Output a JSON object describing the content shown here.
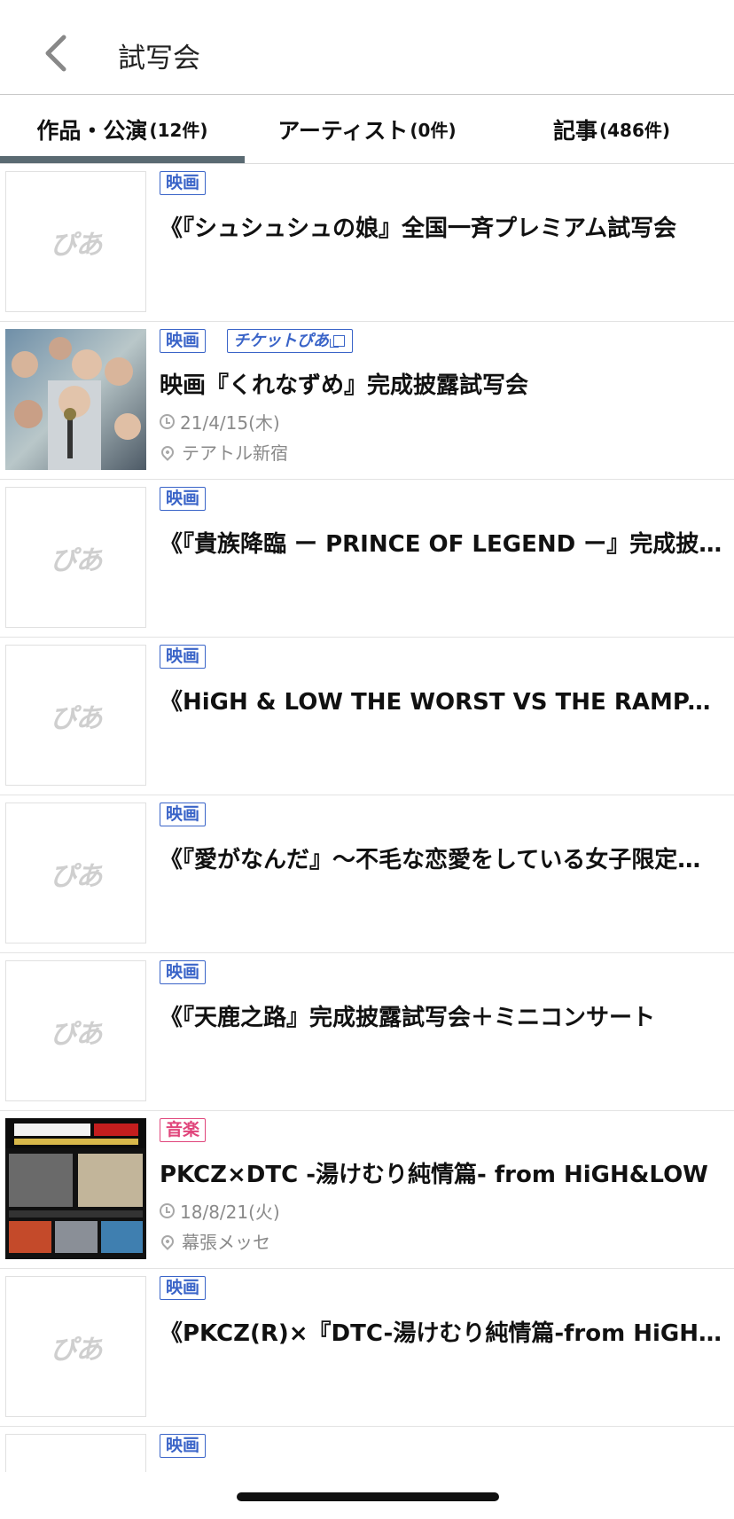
{
  "header": {
    "title": "試写会"
  },
  "tabs": [
    {
      "label": "作品・公演",
      "count": "(12件)",
      "active": true
    },
    {
      "label": "アーティスト",
      "count": "(0件)",
      "active": false
    },
    {
      "label": "記事",
      "count": "(486件)",
      "active": false
    }
  ],
  "placeholder_logo": "ぴあ",
  "ticket_badge": "チケットぴあ",
  "items": [
    {
      "category": "映画",
      "title": "《『シュシュシュの娘』全国一斉プレミアム試写会"
    },
    {
      "category": "映画",
      "title": "映画『くれなずめ』完成披露試写会",
      "date": "21/4/15(木)",
      "venue": "テアトル新宿"
    },
    {
      "category": "映画",
      "title": "《『貴族降臨 ー PRINCE OF LEGEND ー』完成披露試写会"
    },
    {
      "category": "映画",
      "title": "《HiGH & LOW THE WORST VS THE RAMPAGE"
    },
    {
      "category": "映画",
      "title": "《『愛がなんだ』〜不毛な恋愛をしている女子限定試写会"
    },
    {
      "category": "映画",
      "title": "《『天鹿之路』完成披露試写会＋ミニコンサート"
    },
    {
      "category": "音楽",
      "title": "PKCZ×DTC -湯けむり純情篇- from HiGH&LOW",
      "date": "18/8/21(火)",
      "venue": "幕張メッセ"
    },
    {
      "category": "映画",
      "title": "《PKCZ(R)×『DTC-湯けむり純情篇-from HiGH&LOW』"
    },
    {
      "category": "映画"
    }
  ],
  "colors": {
    "movie_badge": "#3a64c8",
    "music_badge": "#e0457b",
    "tab_indicator": "#5a6a72"
  }
}
